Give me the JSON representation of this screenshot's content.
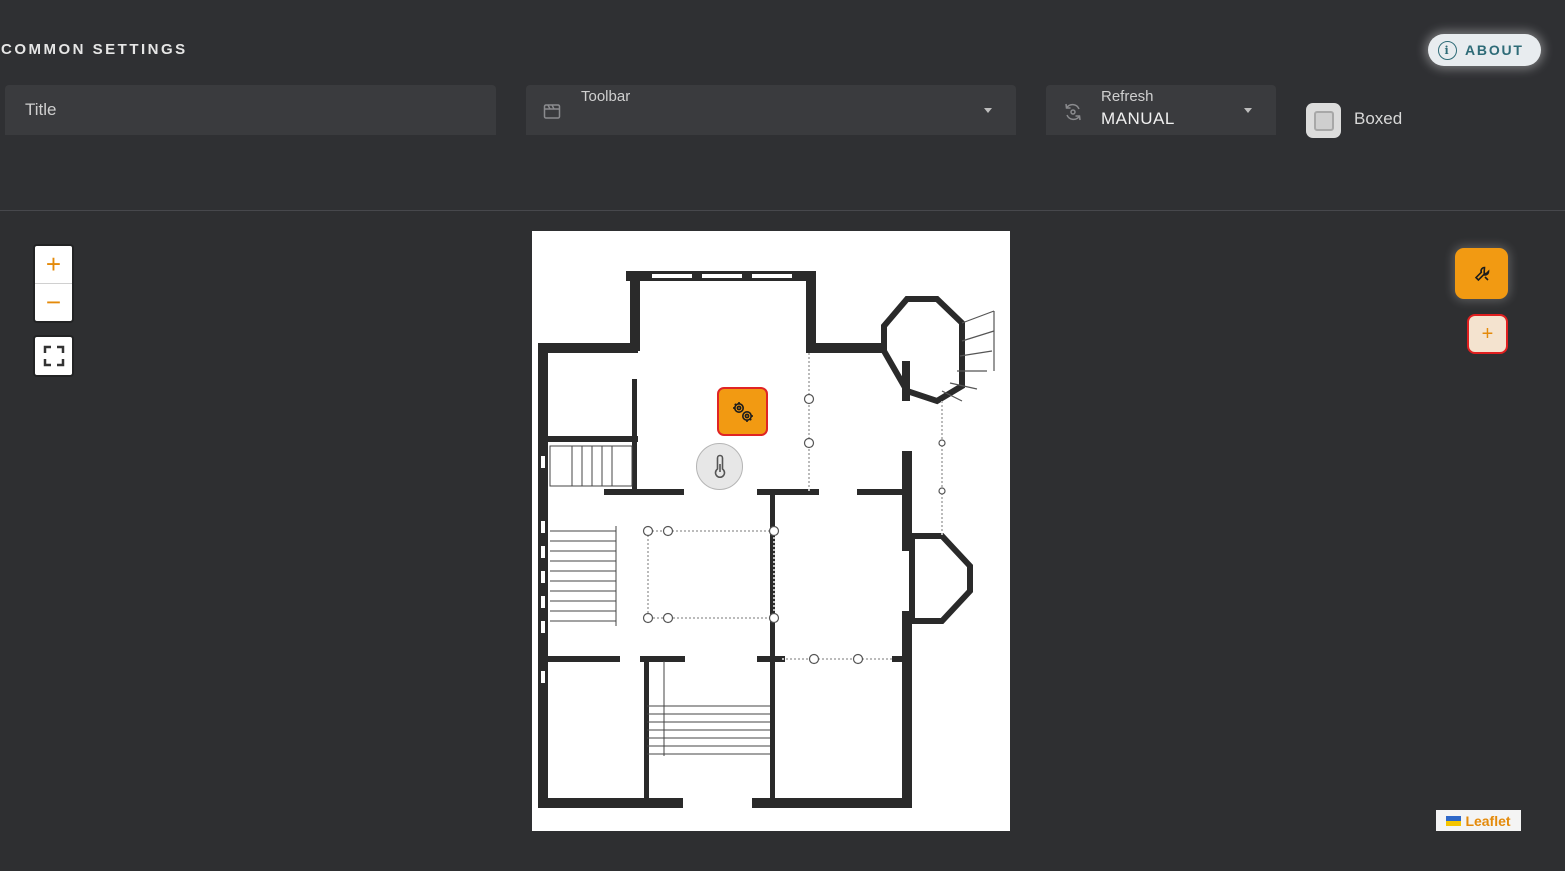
{
  "header": {
    "section_title": "COMMON SETTINGS",
    "about_label": "ABOUT"
  },
  "fields": {
    "title_placeholder": "Title",
    "toolbar_label": "Toolbar",
    "toolbar_value": "",
    "refresh_label": "Refresh",
    "refresh_value": "MANUAL",
    "boxed_label": "Boxed",
    "boxed_checked": false
  },
  "map": {
    "zoom_in": "+",
    "zoom_out": "−",
    "add_label": "+",
    "attribution": "Leaflet",
    "icons": {
      "fullscreen": "fullscreen-icon",
      "edit": "wrench-icon",
      "marker_1": "gears-icon",
      "marker_2": "thermometer-icon"
    }
  },
  "colors": {
    "accent": "#f29a12",
    "selection": "#e02424",
    "background": "#2f3033",
    "about_text": "#2e6b77"
  }
}
